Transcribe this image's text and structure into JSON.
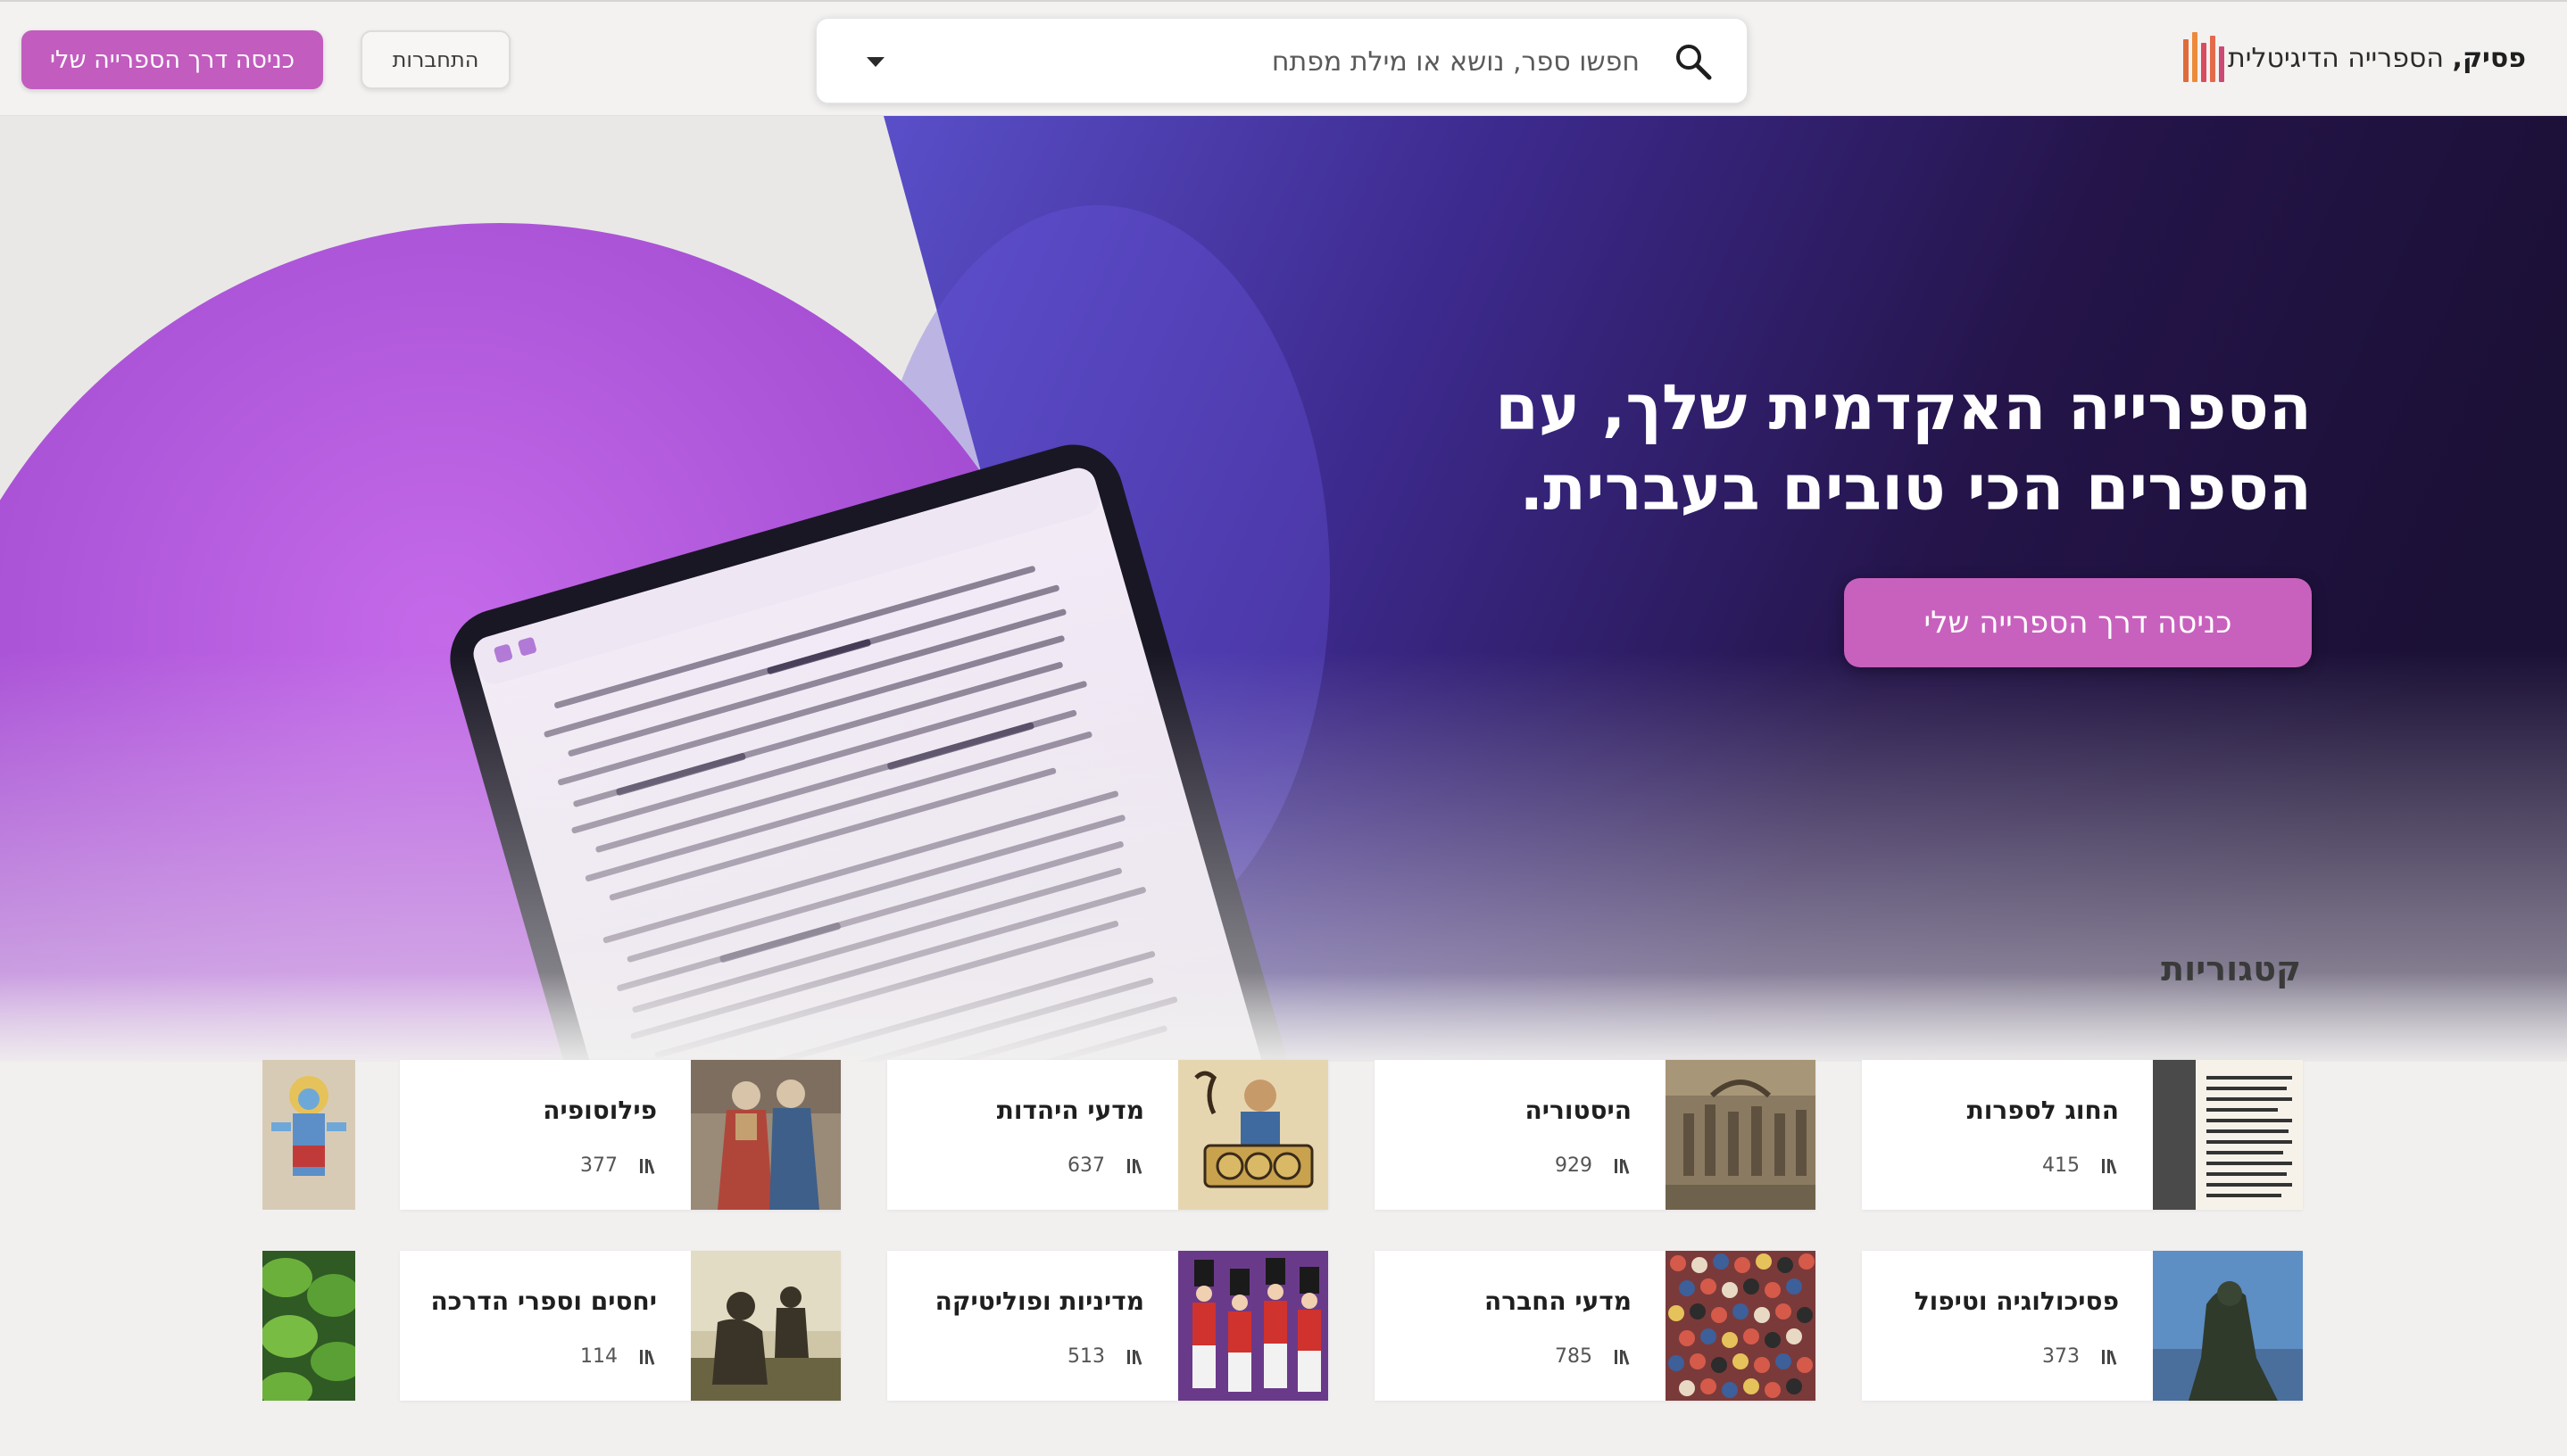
{
  "header": {
    "brand_name": "פסיק,",
    "brand_tagline": "הספרייה הדיגיטלית",
    "search": {
      "placeholder": "חפשו ספר, נושא או מילת מפתח"
    },
    "login_label": "התחברות",
    "enter_label": "כניסה דרך הספרייה שלי"
  },
  "hero": {
    "title": "הספרייה האקדמית שלך, עם הספרים הכי טובים בעברית.",
    "cta_label": "כניסה דרך הספרייה שלי"
  },
  "categories": {
    "heading": "קטגוריות",
    "items": [
      {
        "title": "החוג לספרות",
        "count": "415",
        "icon": "manuscript-thumb"
      },
      {
        "title": "היסטוריה",
        "count": "929",
        "icon": "relief-thumb"
      },
      {
        "title": "מדעי היהדות",
        "count": "637",
        "icon": "illumination-thumb"
      },
      {
        "title": "פילוסופיה",
        "count": "377",
        "icon": "philosophers-thumb"
      },
      {
        "title": "פסיכולוגיה וטיפול",
        "count": "373",
        "icon": "thinker-thumb"
      },
      {
        "title": "מדעי החברה",
        "count": "785",
        "icon": "crowd-thumb"
      },
      {
        "title": "מדיניות ופוליטיקה",
        "count": "513",
        "icon": "soldiers-thumb"
      },
      {
        "title": "יחסים וספרי הדרכה",
        "count": "114",
        "icon": "parent-child-thumb"
      }
    ]
  },
  "colors": {
    "accent": "#c25cbf",
    "hero_dark": "#1d1240",
    "hero_purple": "#a64fd4"
  }
}
